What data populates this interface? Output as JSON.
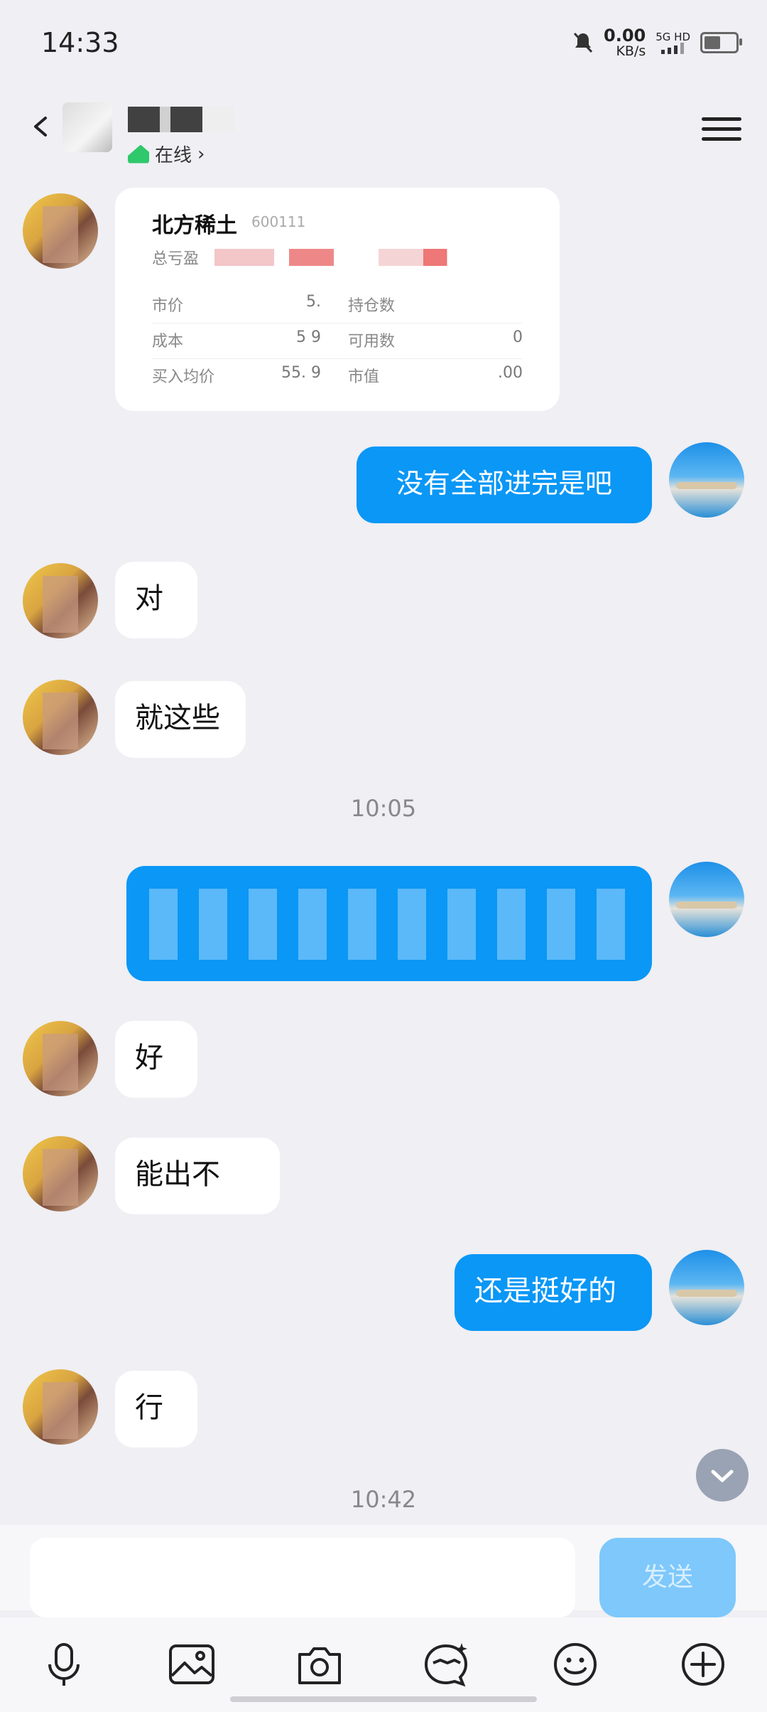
{
  "status_bar": {
    "time": "14:33",
    "net_speed": "0.00",
    "net_unit": "KB/s",
    "network": "5G HD"
  },
  "header": {
    "contact_name": "",
    "status": "在线"
  },
  "stock_card": {
    "name": "北方稀土",
    "code": "600111",
    "total_pl_label": "总亏盈",
    "total_pl_value": "",
    "rows": [
      {
        "l1": "市价",
        "v1": "5.",
        "l2": "持仓数",
        "v2": ""
      },
      {
        "l1": "成本",
        "v1": "5 9",
        "l2": "可用数",
        "v2": "0"
      },
      {
        "l1": "买入均价",
        "v1": "55. 9",
        "l2": "市值",
        "v2": ".00"
      }
    ]
  },
  "messages": [
    {
      "dir": "out",
      "text": "没有全部进完是吧"
    },
    {
      "dir": "in",
      "text": "对"
    },
    {
      "dir": "in",
      "text": "就这些"
    },
    {
      "dir": "time",
      "text": "10:05"
    },
    {
      "dir": "out",
      "text": ""
    },
    {
      "dir": "in",
      "text": "好"
    },
    {
      "dir": "in",
      "text": "能出不"
    },
    {
      "dir": "out",
      "text": "还是挺好的"
    },
    {
      "dir": "in",
      "text": "行"
    },
    {
      "dir": "time",
      "text": "10:42"
    }
  ],
  "composer": {
    "send_label": "发送"
  },
  "toolbar": {
    "icons": [
      "microphone-icon",
      "image-icon",
      "camera-icon",
      "sticker-icon",
      "emoji-icon",
      "plus-icon"
    ]
  },
  "colors": {
    "outgoing_bubble": "#0a97f6",
    "incoming_bubble": "#ffffff",
    "background": "#efeff4",
    "send_button": "#7ec8fb",
    "online": "#2fc86b"
  }
}
